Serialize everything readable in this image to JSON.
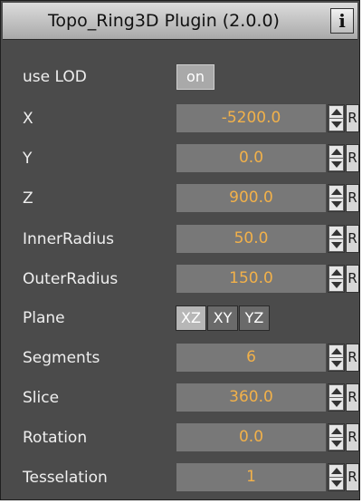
{
  "window": {
    "title": "Topo_Ring3D Plugin (2.0.0)",
    "info_label": "i"
  },
  "use_lod": {
    "label": "use LOD",
    "value": "on"
  },
  "params": [
    {
      "label": "X",
      "value": "-5200.0",
      "reset": "R"
    },
    {
      "label": "Y",
      "value": "0.0",
      "reset": "R"
    },
    {
      "label": "Z",
      "value": "900.0",
      "reset": "R"
    },
    {
      "label": "InnerRadius",
      "value": "50.0",
      "reset": "R"
    },
    {
      "label": "OuterRadius",
      "value": "150.0",
      "reset": "R"
    }
  ],
  "plane": {
    "label": "Plane",
    "options": [
      "XZ",
      "XY",
      "YZ"
    ],
    "selected": "XZ"
  },
  "params2": [
    {
      "label": "Segments",
      "value": "6",
      "reset": "R"
    },
    {
      "label": "Slice",
      "value": "360.0",
      "reset": "R"
    },
    {
      "label": "Rotation",
      "value": "0.0",
      "reset": "R"
    },
    {
      "label": "Tesselation",
      "value": "1",
      "reset": "R"
    }
  ],
  "colors": {
    "panel_bg": "#4b4b4b",
    "field_bg": "#787878",
    "value_text": "#f2b14a",
    "label_text": "#efefef"
  }
}
